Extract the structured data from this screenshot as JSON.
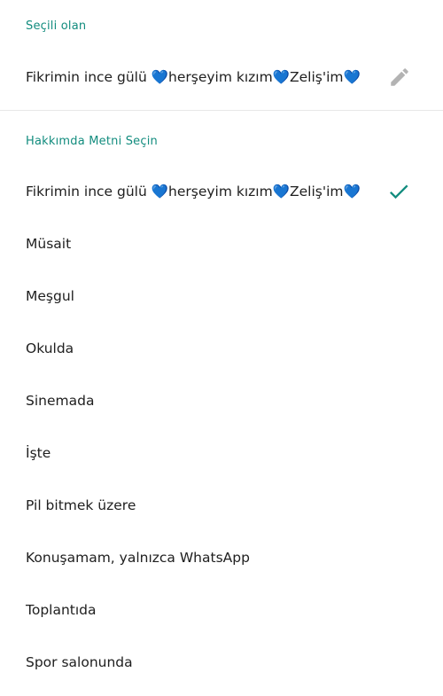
{
  "current": {
    "header": "Seçili olan",
    "text": "Fikrimin ince gülü 💙herşeyim kızım💙Zeliş'im💙",
    "edit_icon": "pencil-icon"
  },
  "select": {
    "header": "Hakkımda Metni Seçin",
    "selected_icon": "check-icon",
    "options": [
      {
        "label": "Fikrimin ince gülü 💙herşeyim kızım💙Zeliş'im💙",
        "selected": true
      },
      {
        "label": "Müsait"
      },
      {
        "label": "Meşgul"
      },
      {
        "label": "Okulda"
      },
      {
        "label": "Sinemada"
      },
      {
        "label": "İşte"
      },
      {
        "label": "Pil bitmek üzere"
      },
      {
        "label": "Konuşamam, yalnızca WhatsApp"
      },
      {
        "label": "Toplantıda"
      },
      {
        "label": "Spor salonunda"
      }
    ]
  },
  "colors": {
    "accent": "#128c7e",
    "icon_gray": "#b3b3b3",
    "divider": "#e8e8e8"
  }
}
